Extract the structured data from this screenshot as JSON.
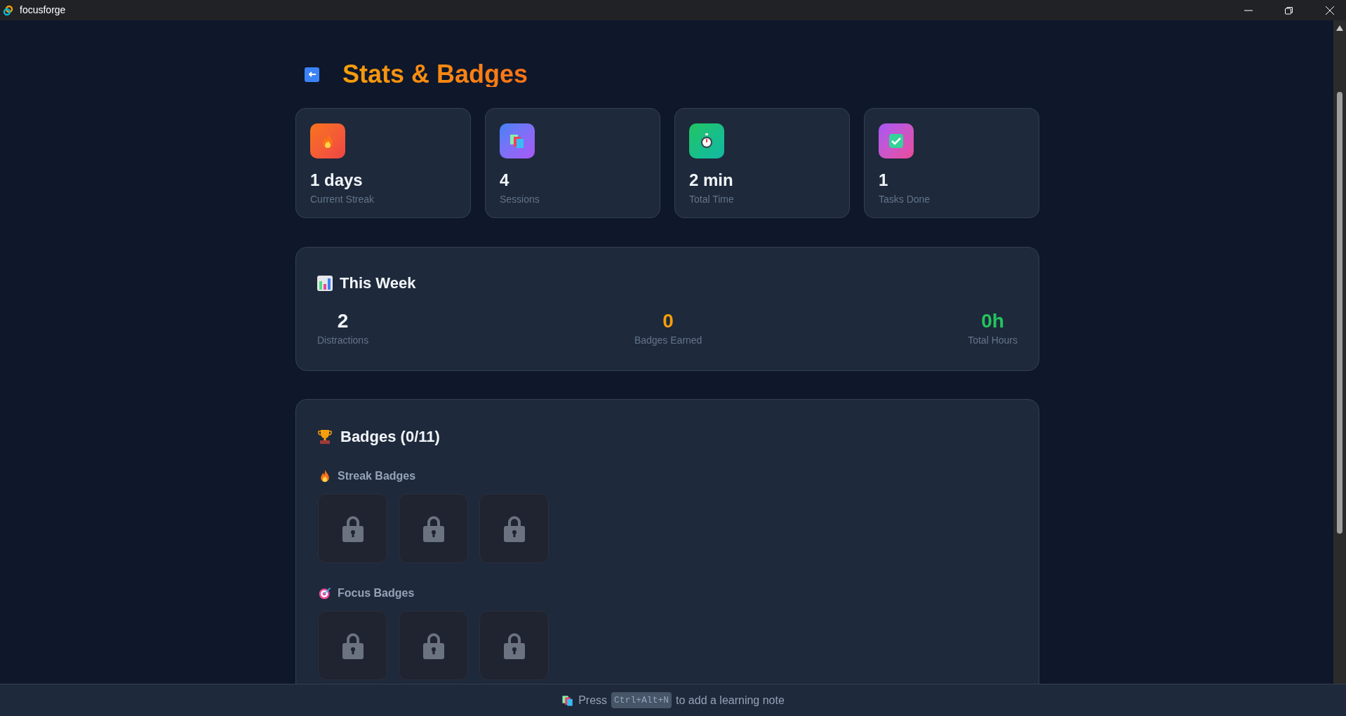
{
  "window": {
    "title": "focusforge"
  },
  "page": {
    "title": "Stats & Badges"
  },
  "stats": [
    {
      "value": "1 days",
      "label": "Current Streak"
    },
    {
      "value": "4",
      "label": "Sessions"
    },
    {
      "value": "2 min",
      "label": "Total Time"
    },
    {
      "value": "1",
      "label": "Tasks Done"
    }
  ],
  "this_week": {
    "title": "This Week",
    "items": [
      {
        "value": "2",
        "label": "Distractions",
        "color": "#f1f5f9"
      },
      {
        "value": "0",
        "label": "Badges Earned",
        "color": "#f59e0b"
      },
      {
        "value": "0h",
        "label": "Total Hours",
        "color": "#22c55e"
      }
    ]
  },
  "badges": {
    "title": "Badges (0/11)",
    "groups": [
      {
        "title": "Streak Badges",
        "badges": [
          {
            "locked": true
          },
          {
            "locked": true
          },
          {
            "locked": true
          }
        ]
      },
      {
        "title": "Focus Badges",
        "badges": [
          {
            "locked": true
          },
          {
            "locked": true
          },
          {
            "locked": true
          }
        ]
      }
    ]
  },
  "footer": {
    "before": "Press",
    "key": "Ctrl+Alt+N",
    "after": "to add a learning note"
  }
}
